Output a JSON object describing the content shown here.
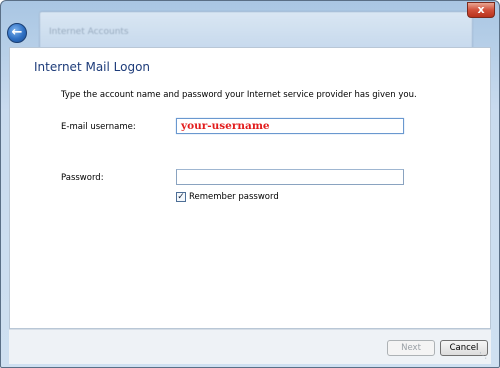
{
  "window": {
    "background_title": "Internet Accounts",
    "close_label": "x"
  },
  "page": {
    "heading": "Internet Mail Logon",
    "instruction": "Type the account name and password your Internet service provider has given you."
  },
  "form": {
    "email_label": "E-mail username:",
    "email_value": "your-username",
    "password_label": "Password:",
    "password_value": "",
    "remember_label": "Remember password",
    "remember_checked": true
  },
  "footer": {
    "next_label": "Next",
    "cancel_label": "Cancel"
  },
  "colors": {
    "accent": "#1e3c7a",
    "username_text": "#e21c1c"
  }
}
